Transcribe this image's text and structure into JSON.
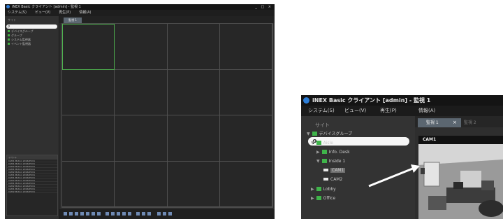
{
  "left_window": {
    "title": "iNEX Basic クライアント [admin] - 監視 1",
    "window_controls": "_ □ ×",
    "menu": [
      "システム(S)",
      "ビュー(V)",
      "再生(P)",
      "情報(A)"
    ],
    "site_label": "サイト",
    "search_icon": "search-icon",
    "tree": [
      "デバイスグループ",
      "グループ",
      "システム監視器",
      "イベント監視器"
    ],
    "tab1": "監視 1",
    "grid": {
      "columns": 4,
      "rows": 4,
      "selected_cell": 1
    },
    "list_header": "イベント",
    "list_rows": [
      "CAM1 Motion 2016/05/01",
      "CAM1 Motion 2016/05/01",
      "CAM2 Motion 2016/05/01",
      "CAM1 Motion 2016/05/01",
      "CAM2 Motion 2016/05/01",
      "CAM1 Motion 2016/05/01",
      "CAM1 Motion 2016/05/01",
      "CAM2 Motion 2016/05/01",
      "CAM1 Motion 2016/05/01",
      "CAM2 Motion 2016/05/01",
      "CAM1 Motion 2016/05/01",
      "CAM2 Motion 2016/05/01"
    ]
  },
  "right_window": {
    "title": "iNEX Basic クライアント [admin] - 監視 1",
    "menu": [
      "システム(S)",
      "ビュー(V)",
      "再生(P)",
      "情報(A)"
    ],
    "site_label": "サイト",
    "search_icon_glyph": "ρ,",
    "tree": [
      {
        "label": "デバイスグループ",
        "icon": "group",
        "caret": "▼"
      },
      {
        "label": "Aisle",
        "icon": "group",
        "caret": "▼"
      },
      {
        "label": "Info. Desk",
        "icon": "device",
        "caret": "▶"
      },
      {
        "label": "Inside 1",
        "icon": "device",
        "caret": "▼"
      },
      {
        "label": "CAM1",
        "icon": "camera",
        "caret": "",
        "selected": true
      },
      {
        "label": "CAM2",
        "icon": "camera",
        "caret": ""
      },
      {
        "label": "Lobby",
        "icon": "group",
        "caret": "▶"
      },
      {
        "label": "Office",
        "icon": "group",
        "caret": "▶"
      }
    ],
    "tab1": "監視 1",
    "tab1_close": "×",
    "tab2": "監視 2",
    "camera_header": "CAM1"
  },
  "colors": {
    "accent_green": "#3fb44a",
    "selected_cell": "#4fb24f",
    "tab_active": "#5b6670",
    "app_bg": "#2e2e2e"
  }
}
